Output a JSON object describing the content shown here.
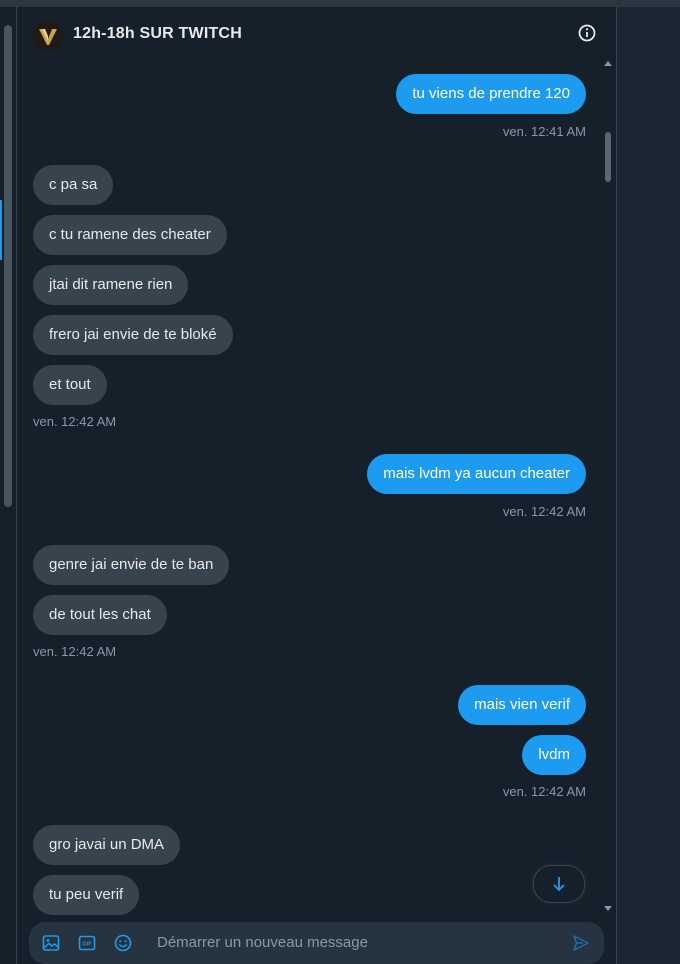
{
  "header": {
    "title": "12h-18h SUR TWITCH",
    "logo_icon": "channel-logo",
    "info_icon": "info-icon"
  },
  "messages": [
    {
      "type": "sent",
      "text": "tu viens de prendre 120"
    },
    {
      "type": "timestamp-right",
      "text": "ven. 12:41 AM"
    },
    {
      "type": "recv",
      "text": "c pa sa"
    },
    {
      "type": "recv",
      "text": "c tu ramene des cheater"
    },
    {
      "type": "recv",
      "text": "jtai dit ramene rien"
    },
    {
      "type": "recv",
      "text": "frero jai envie de te bloké"
    },
    {
      "type": "recv",
      "text": "et tout"
    },
    {
      "type": "timestamp-left",
      "text": "ven. 12:42 AM"
    },
    {
      "type": "sent",
      "text": "mais lvdm ya aucun cheater"
    },
    {
      "type": "timestamp-right",
      "text": "ven. 12:42 AM"
    },
    {
      "type": "recv",
      "text": "genre jai envie de te ban"
    },
    {
      "type": "recv",
      "text": "de tout les chat"
    },
    {
      "type": "timestamp-left",
      "text": "ven. 12:42 AM"
    },
    {
      "type": "sent",
      "text": "mais vien verif"
    },
    {
      "type": "sent",
      "text": "lvdm"
    },
    {
      "type": "timestamp-right",
      "text": "ven. 12:42 AM"
    },
    {
      "type": "recv",
      "text": "gro javai un DMA"
    },
    {
      "type": "recv",
      "text": "tu peu verif"
    }
  ],
  "composer": {
    "placeholder": "Démarrer un nouveau message",
    "media_icon": "image-icon",
    "gif_icon": "gif-icon",
    "gif_label": "GIF",
    "emoji_icon": "emoji-icon",
    "send_icon": "send-icon"
  },
  "scroll_down_icon": "arrow-down-icon",
  "colors": {
    "background": "#15202b",
    "sent_bubble": "#1d9bf0",
    "received_bubble": "#38444d",
    "timestamp": "#8b98a5"
  }
}
